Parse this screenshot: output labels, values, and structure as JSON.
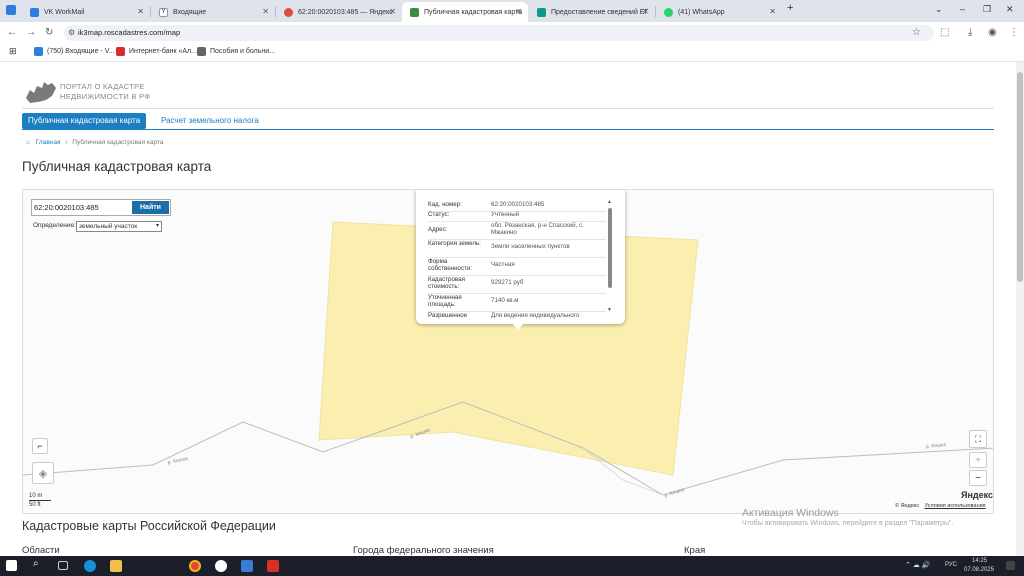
{
  "browser": {
    "tabs": [
      {
        "label": "VK WorkMail",
        "color": "#2d7de0"
      },
      {
        "label": "Входящие",
        "color": "#ffffff"
      },
      {
        "label": "62:20:0020103:485 — Яндекс",
        "color": "#e24a3b"
      },
      {
        "label": "Публичная кадастровая карта",
        "color": "#3c8d40"
      },
      {
        "label": "Предоставление сведений ЕГ",
        "color": "#0d9a88"
      },
      {
        "label": "(41) WhatsApp",
        "color": "#25d366"
      }
    ],
    "new_tab": "+",
    "window_controls": [
      "⌄",
      "–",
      "❐",
      "✕"
    ],
    "url": "ik3map.roscadastres.com/map",
    "bookmarks": [
      {
        "label": "(750) Входящие - V...",
        "color": "#2d7de0"
      },
      {
        "label": "Интернет-банк «Ал...",
        "color": "#d92c2c"
      },
      {
        "label": "Пособия и больни...",
        "color": "#666666"
      }
    ]
  },
  "site": {
    "logo_text_line1": "ПОРТАЛ О КАДАСТРЕ",
    "logo_text_line2": "НЕДВИЖИМОСТИ В РФ",
    "nav_tab_active": "Публичная кадастровая карта",
    "nav_tab_second": "Расчет земельного налога",
    "breadcrumb_home": "Главная",
    "breadcrumb_sep": "›",
    "breadcrumb_current": "Публичная кадастровая карта",
    "page_title": "Публичная кадастровая карта"
  },
  "map": {
    "search_value": "62:20:0020103:485",
    "search_button": "Найти",
    "definition_label": "Определение:",
    "definition_value": "земельный участок",
    "road_labels": [
      "р. Кишка",
      "р. Кишка",
      "р. Кишка",
      "р. Кишка"
    ],
    "scale_m": "10 m",
    "scale_ft": "50 ft",
    "copyright": "© Яндекс",
    "terms": "Условия использования",
    "yandex_logo": "Яндекс",
    "zoom_in": "+",
    "zoom_out": "−",
    "parcel_color": "#fbefb0"
  },
  "popup": {
    "rows": [
      {
        "k": "Кад. номер:",
        "v": "62:20:0020103:485"
      },
      {
        "k": "Статус:",
        "v": "Учтенный"
      },
      {
        "k": "Адрес:",
        "v": "обл. Рязанская, р-н Спасский, с. Мжакино"
      },
      {
        "k": "Категория земель:",
        "v": "Земли населенных пунктов"
      },
      {
        "k": "Форма собственности:",
        "v": "Частная"
      },
      {
        "k": "Кадастровая стоимость:",
        "v": "929271 руб"
      },
      {
        "k": "Уточненная площадь:",
        "v": "7140 кв.м"
      },
      {
        "k": "Разрешенное",
        "v": "Для ведения индивидуального"
      }
    ]
  },
  "watermark": {
    "title": "Активация Windows",
    "sub": "Чтобы активировать Windows, перейдите в раздел \"Параметры\"."
  },
  "lower": {
    "heading": "Кадастровые карты Российской Федерации",
    "col1": "Области",
    "col2": "Города федерального значения",
    "col3": "Края"
  },
  "taskbar": {
    "lang": "РУС",
    "time": "14:25",
    "date": "07.08.2025"
  }
}
